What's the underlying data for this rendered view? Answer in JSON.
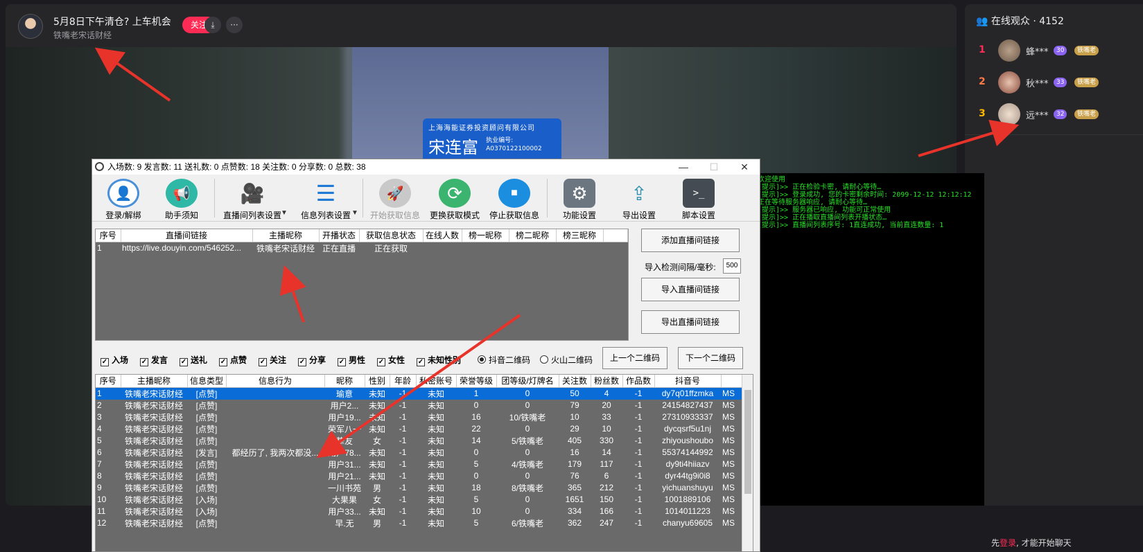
{
  "live": {
    "title": "5月8日下午清仓? 上车机会",
    "host": "铁嘴老宋话财经",
    "follow_label": "关注",
    "download_icon": "⤓",
    "more_icon": "···"
  },
  "badge": {
    "company": "上海海能证券投资顾问有限公司",
    "name": "宋连富",
    "license_label": "执业编号:",
    "license_no": "A0370122100002"
  },
  "audience": {
    "title": "在线观众 · 4152",
    "viewers": [
      {
        "rank": "1",
        "name": "蜂***",
        "level": "30",
        "fan": "铁嘴老",
        "rank_color": "#fe2c55"
      },
      {
        "rank": "2",
        "name": "秋***",
        "level": "33",
        "fan": "铁嘴老",
        "rank_color": "#ff7a45"
      },
      {
        "rank": "3",
        "name": "远***",
        "level": "32",
        "fan": "铁嘴老",
        "rank_color": "#ffb700"
      }
    ]
  },
  "chat_hint": {
    "prefix": "先",
    "login": "登录",
    "suffix": ", 才能开始聊天"
  },
  "tool": {
    "stats": "入场数: 9   发言数: 11   送礼数: 0   点赞数: 18   关注数: 0   分享数: 0   总数: 38",
    "minimize": "—",
    "maximize": "☐",
    "close": "✕",
    "toolbar": [
      {
        "label": "登录/解绑",
        "icon": "👤",
        "color": "#4a90d9"
      },
      {
        "label": "助手须知",
        "icon": "📢",
        "color": "#2fb8a6"
      },
      {
        "label": "直播间列表设置",
        "icon": "🎥",
        "color": "#2aa7e0"
      },
      {
        "label": "信息列表设置",
        "icon": "☰",
        "color": "#1f7ad6"
      },
      {
        "label": "开始获取信息",
        "icon": "🚀",
        "color": "#bbbbbb"
      },
      {
        "label": "更换获取模式",
        "icon": "⟳",
        "color": "#3ab46e"
      },
      {
        "label": "停止获取信息",
        "icon": "■",
        "color": "#1b8ee0"
      },
      {
        "label": "功能设置",
        "icon": "⚙",
        "color": "#6b7680"
      },
      {
        "label": "导出设置",
        "icon": "⇪",
        "color": "#2d8fb0"
      },
      {
        "label": "脚本设置",
        "icon": ">_",
        "color": "#444b52"
      }
    ],
    "room_table": {
      "headers": [
        "序号",
        "直播间链接",
        "主播昵称",
        "开播状态",
        "获取信息状态",
        "在线人数",
        "榜一昵称",
        "榜二昵称",
        "榜三昵称"
      ],
      "rows": [
        [
          "1",
          "https://live.douyin.com/546252...",
          "铁嘴老宋话财经",
          "正在直播",
          "正在获取",
          "",
          "",
          "",
          ""
        ]
      ]
    },
    "buttons": {
      "add_room": "添加直播间链接",
      "interval_label": "导入检测间隔/毫秒:",
      "interval_value": "500",
      "import_room": "导入直播间链接",
      "export_room": "导出直播间链接",
      "prev_qr": "上一个二维码",
      "next_qr": "下一个二维码"
    },
    "filters": [
      "入场",
      "发言",
      "送礼",
      "点赞",
      "关注",
      "分享",
      "男性",
      "女性",
      "未知性别"
    ],
    "radios": [
      "抖音二维码",
      "火山二维码"
    ],
    "info_table": {
      "headers": [
        "序号",
        "主播昵称",
        "信息类型",
        "信息行为",
        "昵称",
        "性别",
        "年龄",
        "私密账号",
        "荣誉等级",
        "团等级/灯牌名",
        "关注数",
        "粉丝数",
        "作品数",
        "抖音号",
        ""
      ],
      "rows": [
        [
          "1",
          "铁嘴老宋话财经",
          "[点赞]",
          "",
          "瑜意",
          "未知",
          "-1",
          "未知",
          "1",
          "0",
          "50",
          "4",
          "-1",
          "dy7q01ffzmka",
          "MS"
        ],
        [
          "2",
          "铁嘴老宋话财经",
          "[点赞]",
          "",
          "用户2...",
          "未知",
          "-1",
          "未知",
          "0",
          "0",
          "79",
          "20",
          "-1",
          "24154827437",
          "MS"
        ],
        [
          "3",
          "铁嘴老宋话财经",
          "[点赞]",
          "",
          "用户19...",
          "未知",
          "-1",
          "未知",
          "16",
          "10/铁嘴老",
          "10",
          "33",
          "-1",
          "27310933337",
          "MS"
        ],
        [
          "4",
          "铁嘴老宋话财经",
          "[点赞]",
          "",
          "荣军八一",
          "未知",
          "-1",
          "未知",
          "22",
          "0",
          "29",
          "10",
          "-1",
          "dycqsrf5u1nj",
          "MS"
        ],
        [
          "5",
          "铁嘴老宋话财经",
          "[点赞]",
          "",
          "挚友",
          "女",
          "-1",
          "未知",
          "14",
          "5/铁嘴老",
          "405",
          "330",
          "-1",
          "zhiyoushoubo",
          "MS"
        ],
        [
          "6",
          "铁嘴老宋话财经",
          "[发言]",
          "都经历了, 我两次都没...",
          "用户78...",
          "未知",
          "-1",
          "未知",
          "0",
          "0",
          "16",
          "14",
          "-1",
          "55374144992",
          "MS"
        ],
        [
          "7",
          "铁嘴老宋话财经",
          "[点赞]",
          "",
          "用户31...",
          "未知",
          "-1",
          "未知",
          "5",
          "4/铁嘴老",
          "179",
          "117",
          "-1",
          "dy9ti4hiiazv",
          "MS"
        ],
        [
          "8",
          "铁嘴老宋话财经",
          "[点赞]",
          "",
          "用户21...",
          "未知",
          "-1",
          "未知",
          "0",
          "0",
          "76",
          "6",
          "-1",
          "dyr44tg9i0i8",
          "MS"
        ],
        [
          "9",
          "铁嘴老宋话财经",
          "[点赞]",
          "",
          "一川书苑",
          "男",
          "-1",
          "未知",
          "18",
          "8/铁嘴老",
          "365",
          "212",
          "-1",
          "yichuanshuyu",
          "MS"
        ],
        [
          "10",
          "铁嘴老宋话财经",
          "[入场]",
          "",
          "大果果",
          "女",
          "-1",
          "未知",
          "5",
          "0",
          "1651",
          "150",
          "-1",
          "1001889106",
          "MS"
        ],
        [
          "11",
          "铁嘴老宋话财经",
          "[入场]",
          "",
          "用户33...",
          "未知",
          "-1",
          "未知",
          "10",
          "0",
          "334",
          "166",
          "-1",
          "1014011223",
          "MS"
        ],
        [
          "12",
          "铁嘴老宋话财经",
          "[点赞]",
          "",
          "早.无",
          "男",
          "-1",
          "未知",
          "5",
          "6/铁嘴老",
          "362",
          "247",
          "-1",
          "chanyu69605",
          "MS"
        ]
      ]
    }
  },
  "console": [
    "欢迎使用",
    "[提示]>> 正在检验卡密, 请耐心等待…",
    "[提示]>> 登录成功, 您的卡密剩余时间: 2099-12-12 12:12:12",
    "        正在等待服务器响应, 请耐心等待…",
    "[提示]>> 服务器已响应, 功能可正常使用",
    "[提示]>> 正在播取直播间列表开播状态…",
    "[提示]>> 直播间列表序号: 1直连成功, 当前直连数量: 1"
  ],
  "colors": {
    "accent": "#fe2c55",
    "console_text": "#28e028",
    "selection": "#0a6cd6"
  }
}
